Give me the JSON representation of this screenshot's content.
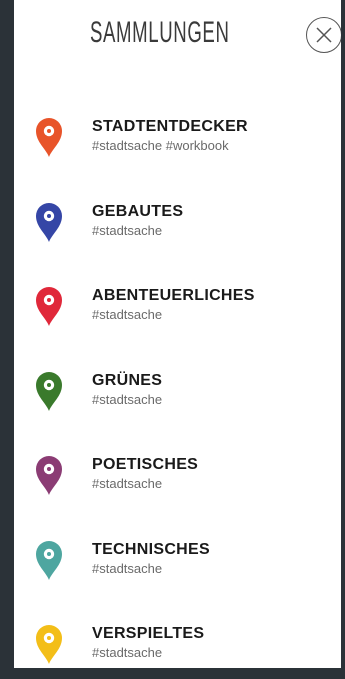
{
  "header": {
    "title": "SAMMLUNGEN",
    "close_icon": "close-circle-icon"
  },
  "collections": [
    {
      "name": "STADTENTDECKER",
      "tags": "#stadtsache #workbook",
      "color": "#e8542a"
    },
    {
      "name": "GEBAUTES",
      "tags": "#stadtsache",
      "color": "#3546a6"
    },
    {
      "name": "ABENTEUERLICHES",
      "tags": "#stadtsache",
      "color": "#e0283a"
    },
    {
      "name": "GRÜNES",
      "tags": "#stadtsache",
      "color": "#3a7a2c"
    },
    {
      "name": "POETISCHES",
      "tags": "#stadtsache",
      "color": "#8b3c74"
    },
    {
      "name": "TECHNISCHES",
      "tags": "#stadtsache",
      "color": "#4ea6a0"
    },
    {
      "name": "VERSPIELTES",
      "tags": "#stadtsache",
      "color": "#f3be18"
    }
  ]
}
